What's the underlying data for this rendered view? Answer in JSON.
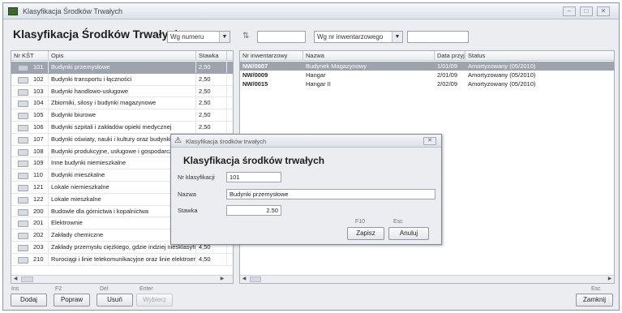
{
  "window": {
    "title": "Klasyfikacja Środków Trwałych",
    "controls": [
      "–",
      "□",
      "✕"
    ]
  },
  "toolbar": {
    "heading": "Klasyfikacja Środków Trwałych",
    "search_mode_1": "Wg numeru",
    "search_value_1": "",
    "search_mode_2": "Wg nr inwentarzowego",
    "search_value_2": ""
  },
  "left_table": {
    "headers": [
      "Nr KŚT",
      "Opis",
      "Stawka"
    ],
    "rows": [
      {
        "nr": "101",
        "opis": "Budynki przemysłowe",
        "stawka": "2,50",
        "selected": true
      },
      {
        "nr": "102",
        "opis": "Budynki transportu i łączności",
        "stawka": "2,50"
      },
      {
        "nr": "103",
        "opis": "Budynki handlowo-usługowe",
        "stawka": "2,50"
      },
      {
        "nr": "104",
        "opis": "Zbiorniki, silosy i budynki magazynowe",
        "stawka": "2,50"
      },
      {
        "nr": "105",
        "opis": "Budynki biurowe",
        "stawka": "2,50"
      },
      {
        "nr": "106",
        "opis": "Budynki szpitali i zakładów opieki medycznej",
        "stawka": "2,50"
      },
      {
        "nr": "107",
        "opis": "Budynki oświaty, nauki i kultury oraz budynki sportowe",
        "stawka": ""
      },
      {
        "nr": "108",
        "opis": "Budynki produkcyjne, usługowe i gospodarcze",
        "stawka": ""
      },
      {
        "nr": "109",
        "opis": "Inne budynki niemieszkalne",
        "stawka": ""
      },
      {
        "nr": "110",
        "opis": "Budynki mieszkalne",
        "stawka": ""
      },
      {
        "nr": "121",
        "opis": "Lokale niemieszkalne",
        "stawka": ""
      },
      {
        "nr": "122",
        "opis": "Lokale mieszkalne",
        "stawka": ""
      },
      {
        "nr": "200",
        "opis": "Budowle dla górnictwa i kopalnictwa",
        "stawka": ""
      },
      {
        "nr": "201",
        "opis": "Elektrownie",
        "stawka": ""
      },
      {
        "nr": "202",
        "opis": "Zakłady chemiczne",
        "stawka": ""
      },
      {
        "nr": "203",
        "opis": "Zakłady przemysłu ciężkiego, gdzie indziej niesklasyfikowane",
        "stawka": "4,50"
      },
      {
        "nr": "210",
        "opis": "Rurociągi i linie telekomunikacyjne oraz linie elektroenergetyczne",
        "stawka": "4,50"
      }
    ]
  },
  "right_table": {
    "headers": [
      "Nr inwentarzowy",
      "Nazwa",
      "Data przyj",
      "Status"
    ],
    "rows": [
      {
        "nr": "NW/0007",
        "nazwa": "Budynek Magazynowy",
        "data": "1/01/09",
        "status": "Amortyzowany (05/2010)",
        "selected": true
      },
      {
        "nr": "NW/0009",
        "nazwa": "Hangar",
        "data": "2/01/09",
        "status": "Amortyzowany (05/2010)"
      },
      {
        "nr": "NW/0015",
        "nazwa": "Hangar II",
        "data": "2/02/09",
        "status": "Amortyzowany (05/2010)"
      }
    ]
  },
  "bottom_bar": {
    "keys": [
      "Ins",
      "F2",
      "Del",
      "Enter",
      "Esc"
    ],
    "buttons": {
      "add": "Dodaj",
      "edit": "Popraw",
      "delete": "Usuń",
      "choose": "Wybierz",
      "close": "Zamknij"
    }
  },
  "dialog": {
    "title": "Klasyfikacja środków trwałych",
    "heading": "Klasyfikacja środków trwałych",
    "labels": {
      "nr": "Nr klasyfikacji",
      "name": "Nazwa",
      "rate": "Stawka"
    },
    "values": {
      "nr": "101",
      "name": "Budynki przemysłowe",
      "rate": "2.50"
    },
    "keys": {
      "save": "F10",
      "cancel": "Esc"
    },
    "buttons": {
      "save": "Zapisz",
      "cancel": "Anuluj"
    }
  }
}
